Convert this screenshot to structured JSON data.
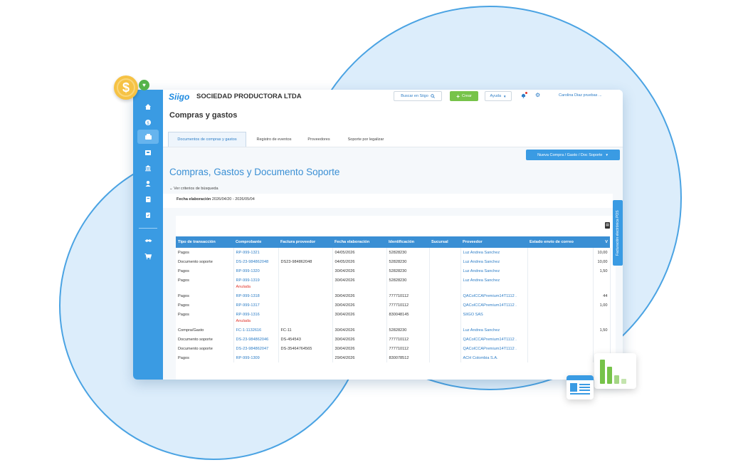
{
  "brand": {
    "logo": "Siigo",
    "company": "SOCIEDAD PRODUCTORA LTDA"
  },
  "topbar": {
    "search_label": "Buscar en Siigo",
    "create_label": "Crear",
    "help_label": "Ayuda",
    "user_label": "Carolina Diaz pruebas ..."
  },
  "page": {
    "title": "Compras y gastos",
    "heading": "Compras, Gastos y Documento Soporte"
  },
  "tabs": [
    {
      "label": "Documentos de compras y gastos"
    },
    {
      "label": "Registro de eventos"
    },
    {
      "label": "Proveedores"
    },
    {
      "label": "Soporte por legalizar"
    }
  ],
  "new_button_label": "Nueva Compra / Gasto / Doc Soporte",
  "criteria_label": "Ver criterios de búsqueda",
  "filter": {
    "label": "Fecha elaboración",
    "value": "2026/04/20 - 2026/05/04"
  },
  "side_tab_label": "Facturación electrónica POS",
  "table": {
    "columns": [
      "Tipo de transacción",
      "Comprobante",
      "Factura proveedor",
      "Fecha elaboración",
      "Identificación",
      "Sucursal",
      "Proveedor",
      "Estado envío de correo",
      "V"
    ],
    "rows": [
      {
        "tipo": "Pagos",
        "comprobante": "RP-999-1321",
        "estado": "",
        "factura": "",
        "fecha": "04/05/2026",
        "id": "52828230",
        "sucursal": "",
        "proveedor": "Luz Andrea Sanchez",
        "correo": "",
        "valor": "10,00"
      },
      {
        "tipo": "Documento soporte",
        "comprobante": "DS-23-984862048",
        "estado": "",
        "factura": "DS23-984862048",
        "fecha": "04/05/2026",
        "id": "52828230",
        "sucursal": "",
        "proveedor": "Luz Andrea Sanchez",
        "correo": "",
        "valor": "10,00"
      },
      {
        "tipo": "Pagos",
        "comprobante": "RP-999-1320",
        "estado": "",
        "factura": "",
        "fecha": "30/04/2026",
        "id": "52828230",
        "sucursal": "",
        "proveedor": "Luz Andrea Sanchez",
        "correo": "",
        "valor": "1,50"
      },
      {
        "tipo": "Pagos",
        "comprobante": "RP-999-1319",
        "estado": "Anulada",
        "factura": "",
        "fecha": "30/04/2026",
        "id": "52828230",
        "sucursal": "",
        "proveedor": "Luz Andrea Sanchez",
        "correo": "",
        "valor": ""
      },
      {
        "tipo": "Pagos",
        "comprobante": "RP-999-1318",
        "estado": "",
        "factura": "",
        "fecha": "30/04/2026",
        "id": "777710112",
        "sucursal": "",
        "proveedor": "QACoICCAPremium14T1112 .",
        "correo": "",
        "valor": "44"
      },
      {
        "tipo": "Pagos",
        "comprobante": "RP-999-1317",
        "estado": "",
        "factura": "",
        "fecha": "30/04/2026",
        "id": "777710112",
        "sucursal": "",
        "proveedor": "QACoICCAPremium14T1112 .",
        "correo": "",
        "valor": "1,00"
      },
      {
        "tipo": "Pagos",
        "comprobante": "RP-999-1316",
        "estado": "Anulada",
        "factura": "",
        "fecha": "30/04/2026",
        "id": "830048145",
        "sucursal": "",
        "proveedor": "SIIGO SAS",
        "correo": "",
        "valor": ""
      },
      {
        "tipo": "Compra/Gasto",
        "comprobante": "FC-1-1132616",
        "estado": "",
        "factura": "FC-11",
        "fecha": "30/04/2026",
        "id": "52828230",
        "sucursal": "",
        "proveedor": "Luz Andrea Sanchez",
        "correo": "",
        "valor": "1,50"
      },
      {
        "tipo": "Documento soporte",
        "comprobante": "DS-23-984862046",
        "estado": "",
        "factura": "DS-454543",
        "fecha": "30/04/2026",
        "id": "777710112",
        "sucursal": "",
        "proveedor": "QACoICCAPremium14T1112 .",
        "correo": "",
        "valor": ""
      },
      {
        "tipo": "Documento soporte",
        "comprobante": "DS-23-984862047",
        "estado": "",
        "factura": "DS-35464764565",
        "fecha": "30/04/2026",
        "id": "777710112",
        "sucursal": "",
        "proveedor": "QACoICCAPremium14T1112 .",
        "correo": "",
        "valor": ""
      },
      {
        "tipo": "Pagos",
        "comprobante": "RP-999-1309",
        "estado": "",
        "factura": "",
        "fecha": "29/04/2026",
        "id": "830078512",
        "sucursal": "",
        "proveedor": "ACH Colombia S.A.",
        "correo": "",
        "valor": ""
      }
    ]
  },
  "sidebar_icons": [
    "home-icon",
    "dollar-icon",
    "purchases-icon",
    "inventory-icon",
    "bank-icon",
    "user-icon",
    "book-icon",
    "clipboard-icon",
    "handshake-icon",
    "cart-icon"
  ],
  "decor": {
    "coin_symbol": "$",
    "heart_symbol": "♥"
  },
  "colors": {
    "primary": "#3a9be3",
    "accent_green": "#77c34a",
    "danger": "#e2352b",
    "circle_fill": "#dcedfb"
  }
}
